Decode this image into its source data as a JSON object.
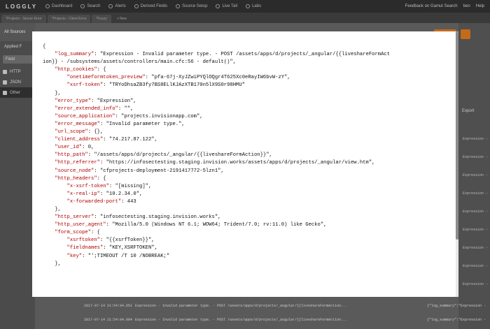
{
  "topnav": {
    "logo": "LOGGLY",
    "items": [
      "Dashboard",
      "Search",
      "Alerts",
      "Derived Fields",
      "Source Setup",
      "Live Tail",
      "Labs"
    ],
    "feedback": "Feedback on Gamut Search",
    "user": "ben",
    "help": "Help"
  },
  "tabs": [
    "*Projects - Server Error",
    "*Projects - Client Error",
    "*Fuzzy",
    "+ New"
  ],
  "sidebar": {
    "all_sources": "All Sources",
    "applied": "Applied F",
    "field_placeholder": "Field",
    "items": [
      "HTTP",
      "JSON",
      "Other"
    ]
  },
  "right_panel": {
    "export": "Export",
    "snippet": "Expression -"
  },
  "log_rows": [
    {
      "timestamp": "2017-07-14 21:54:04.651",
      "message": "Expression - Invalid parameter type. - POST /assets/apps/d/projects/_angular/{{liveshareFormAction...",
      "json": "{\"log_summary\":\"Expression -"
    },
    {
      "timestamp": "2017-07-14 21:54:04.094",
      "message": "Expression - Invalid parameter type. - POST /assets/apps/d/projects/_angular/{{liveshareFormAction...",
      "json": "{\"log_summary\":\"Expression -"
    }
  ],
  "modal": {
    "lines": [
      [
        [
          "p",
          "{"
        ]
      ],
      [
        [
          "p",
          "    "
        ],
        [
          "k",
          "\"log_summary\""
        ],
        [
          "p",
          ": \"Expression - Invalid parameter type. - POST /assets/apps/d/projects/_angular/{{liveshareFormAct"
        ]
      ],
      [
        [
          "p",
          "ion}} - /subsystems/assets/controllers/main.cfc:56 - default()\","
        ]
      ],
      [
        [
          "p",
          "    "
        ],
        [
          "k",
          "\"http_cookies\""
        ],
        [
          "p",
          ": {"
        ]
      ],
      [
        [
          "p",
          "        "
        ],
        [
          "k",
          "\"onetimeformtoken_preview\""
        ],
        [
          "p",
          ": \"pfa-67j-XyJZwiPYQlOQgr4T625Xc0eRayIW6bvW-zY\","
        ]
      ],
      [
        [
          "p",
          "        "
        ],
        [
          "k",
          "\"xsrf-token\""
        ],
        [
          "p",
          ": \"TRYoDhsaZB3fy7BS8ELlKJAzXTB170n5lX9S0r98HMU\""
        ]
      ],
      [
        [
          "p",
          "    },"
        ]
      ],
      [
        [
          "p",
          "    "
        ],
        [
          "k",
          "\"error_type\""
        ],
        [
          "p",
          ": \"Expression\","
        ]
      ],
      [
        [
          "p",
          "    "
        ],
        [
          "k",
          "\"error_extended_info\""
        ],
        [
          "p",
          ": \"\","
        ]
      ],
      [
        [
          "p",
          "    "
        ],
        [
          "k",
          "\"source_application\""
        ],
        [
          "p",
          ": \"projects.invisionapp.com\","
        ]
      ],
      [
        [
          "p",
          "    "
        ],
        [
          "k",
          "\"error_message\""
        ],
        [
          "p",
          ": \"Invalid parameter type.\","
        ]
      ],
      [
        [
          "p",
          "    "
        ],
        [
          "k",
          "\"url_scope\""
        ],
        [
          "p",
          ": {},"
        ]
      ],
      [
        [
          "p",
          "    "
        ],
        [
          "k",
          "\"client_address\""
        ],
        [
          "p",
          ": \"74.217.87.122\","
        ]
      ],
      [
        [
          "p",
          "    "
        ],
        [
          "k",
          "\"user_id\""
        ],
        [
          "p",
          ": 0,"
        ]
      ],
      [
        [
          "p",
          "    "
        ],
        [
          "k",
          "\"http_path\""
        ],
        [
          "p",
          ": \"/assets/apps/d/projects/_angular/{{liveshareFormAction}}\","
        ]
      ],
      [
        [
          "p",
          "    "
        ],
        [
          "k",
          "\"http_referrer\""
        ],
        [
          "p",
          ": \"https://infosectesting.staging.invision.works/assets/apps/d/projects/_angular/view.htm\","
        ]
      ],
      [
        [
          "p",
          "    "
        ],
        [
          "k",
          "\"source_node\""
        ],
        [
          "p",
          ": \"cfprojects-deployment-2191417772-5lzn1\","
        ]
      ],
      [
        [
          "p",
          "    "
        ],
        [
          "k",
          "\"http_headers\""
        ],
        [
          "p",
          ": {"
        ]
      ],
      [
        [
          "p",
          "        "
        ],
        [
          "k",
          "\"x-xsrf-token\""
        ],
        [
          "p",
          ": \"[missing]\","
        ]
      ],
      [
        [
          "p",
          "        "
        ],
        [
          "k",
          "\"x-real-ip\""
        ],
        [
          "p",
          ": \"10.2.34.0\","
        ]
      ],
      [
        [
          "p",
          "        "
        ],
        [
          "k",
          "\"x-forwarded-port\""
        ],
        [
          "p",
          ": 443"
        ]
      ],
      [
        [
          "p",
          "    },"
        ]
      ],
      [
        [
          "p",
          "    "
        ],
        [
          "k",
          "\"http_server\""
        ],
        [
          "p",
          ": \"infosectesting.staging.invision.works\","
        ]
      ],
      [
        [
          "p",
          "    "
        ],
        [
          "k",
          "\"http_user_agent\""
        ],
        [
          "p",
          ": \"Mozilla/5.0 (Windows NT 6.1; WOW64; Trident/7.0; rv:11.0) like Gecko\","
        ]
      ],
      [
        [
          "p",
          "    "
        ],
        [
          "k",
          "\"form_scope\""
        ],
        [
          "p",
          ": {"
        ]
      ],
      [
        [
          "p",
          "        "
        ],
        [
          "k",
          "\"xsrftoken\""
        ],
        [
          "p",
          ": \"{{xsrfToken}}\","
        ]
      ],
      [
        [
          "p",
          "        "
        ],
        [
          "k",
          "\"fieldnames\""
        ],
        [
          "p",
          ": \"KEY,XSRFTOKEN\","
        ]
      ],
      [
        [
          "p",
          "        "
        ],
        [
          "k",
          "\"key\""
        ],
        [
          "p",
          ": \"';TIMEOUT /T 10 /NOBREAK;\""
        ]
      ],
      [
        [
          "p",
          "    },"
        ]
      ]
    ]
  }
}
